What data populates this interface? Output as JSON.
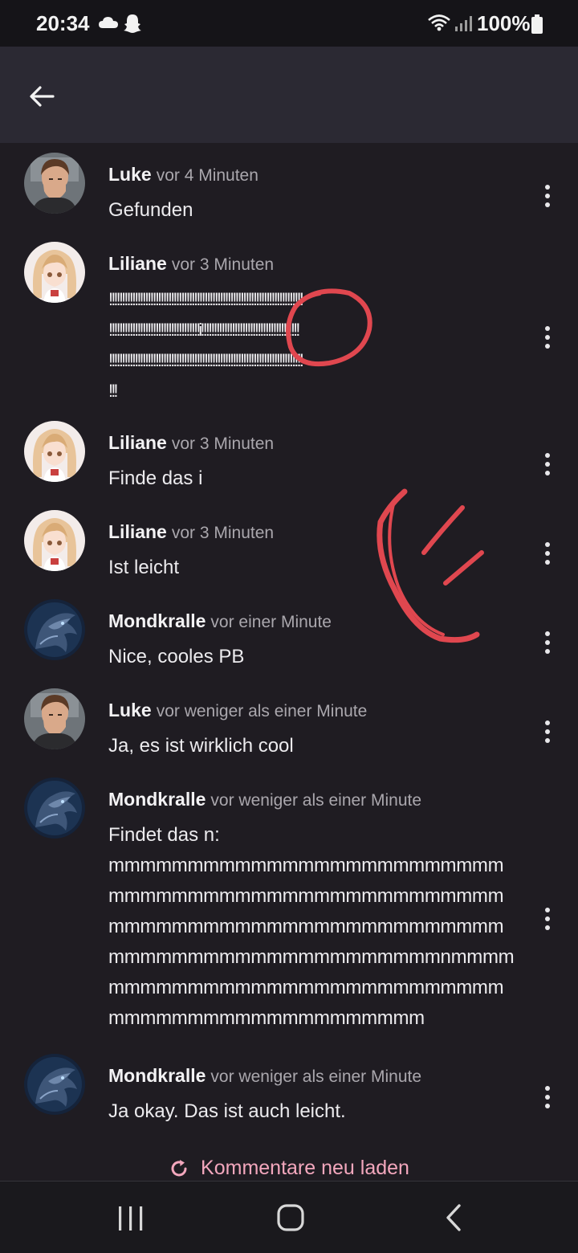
{
  "status_bar": {
    "time": "20:34",
    "battery": "100%",
    "icons": [
      "cloud-icon",
      "snapchat-ghost-icon",
      "wifi-icon",
      "signal-icon",
      "battery-icon"
    ]
  },
  "app_bar": {
    "back_icon": "arrow-left-icon"
  },
  "comments": [
    {
      "author": "Luke",
      "time": "vor 4 Minuten",
      "avatar": "luke-avatar",
      "lines": [
        "Gefunden"
      ]
    },
    {
      "author": "Liliane",
      "time": "vor 3 Minuten",
      "avatar": "liliane-avatar",
      "lines": [
        "!!!!!!!!!!!!!!!!!!!!!!!!!!!!!!!!!!!!!!!!!!!!!!!!!!!!!!!!!!!!!!!!!!!!!!!!!!!",
        "!!!!!!!!!!!!!!!!!!!!!!!!!!!!!!!!!!!i!!!!!!!!!!!!!!!!!!!!!!!!!!!!!!!!!!!!!!",
        "!!!!!!!!!!!!!!!!!!!!!!!!!!!!!!!!!!!!!!!!!!!!!!!!!!!!!!!!!!!!!!!!!!!!!!!!!!!",
        "!!!"
      ]
    },
    {
      "author": "Liliane",
      "time": "vor 3 Minuten",
      "avatar": "liliane-avatar",
      "lines": [
        "Finde das i"
      ]
    },
    {
      "author": "Liliane",
      "time": "vor 3 Minuten",
      "avatar": "liliane-avatar",
      "lines": [
        "Ist leicht"
      ]
    },
    {
      "author": "Mondkralle",
      "time": "vor einer Minute",
      "avatar": "dragon-avatar",
      "lines": [
        "Nice, cooles PB"
      ]
    },
    {
      "author": "Luke",
      "time": "vor weniger als einer Minute",
      "avatar": "luke-avatar",
      "lines": [
        "Ja, es ist wirklich cool"
      ]
    },
    {
      "author": "Mondkralle",
      "time": "vor weniger als einer Minute",
      "avatar": "dragon-avatar",
      "lines": [
        "Findet das n:",
        "mmmmmmmmmmmmmmmmmmmmmmmmm",
        "mmmmmmmmmmmmmmmmmmmmmmmmm",
        "mmmmmmmmmmmmmmmmmmmmmmmmm",
        "mmmmmmmmmmmmmmmmmmmmmnmmmm",
        "mmmmmmmmmmmmmmmmmmmmmmmmm",
        "mmmmmmmmmmmmmmmmmmmm"
      ]
    },
    {
      "author": "Mondkralle",
      "time": "vor weniger als einer Minute",
      "avatar": "dragon-avatar",
      "lines": [
        "Ja okay. Das ist auch leicht."
      ]
    }
  ],
  "reload": {
    "label": "Kommentare neu laden",
    "icon": "refresh-icon"
  },
  "nav_bar": {
    "icons": [
      "recent-apps-icon",
      "home-icon",
      "back-chevron-icon"
    ]
  },
  "colors": {
    "background": "#1f1c22",
    "app_bar": "#2b2933",
    "accent": "#f3a7bd",
    "scribble": "#e0474f"
  }
}
